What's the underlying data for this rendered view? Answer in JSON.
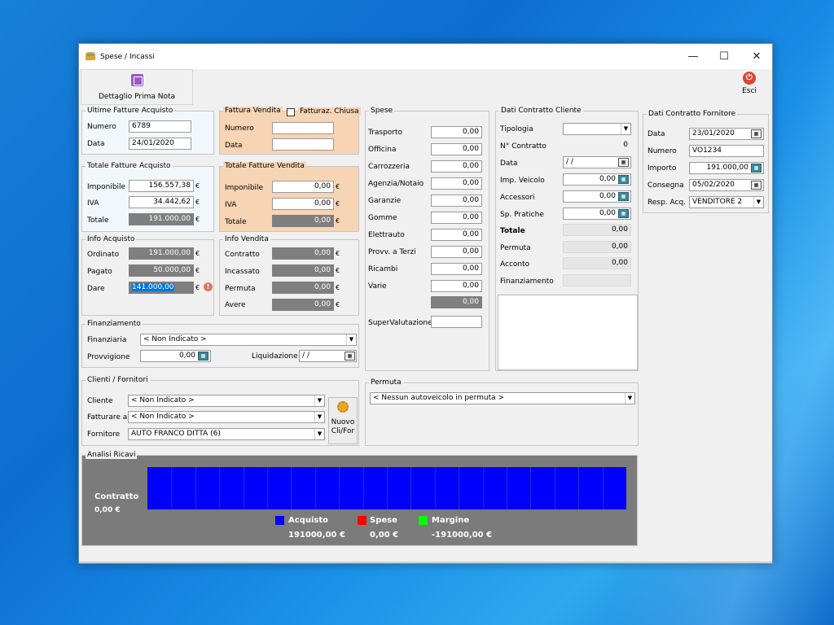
{
  "window": {
    "title": "Spese / Incassi",
    "minimize": "—",
    "maximize": "☐",
    "close": "✕"
  },
  "toolbar": {
    "dettaglio": "Dettaglio Prima Nota",
    "esci": "Esci"
  },
  "ultime_fatture": {
    "title": "Ultime Fatture Acquisto",
    "numero_label": "Numero",
    "numero": "6789",
    "data_label": "Data",
    "data": "24/01/2020"
  },
  "fattura_vendita": {
    "title": "Fattura Vendita",
    "chiusa_label": "Fatturaz. Chiusa",
    "numero_label": "Numero",
    "numero": "",
    "data_label": "Data",
    "data": ""
  },
  "totale_acquisto": {
    "title": "Totale Fatture Acquisto",
    "imponibile_label": "Imponibile",
    "imponibile": "156.557,38",
    "iva_label": "IVA",
    "iva": "34.442,62",
    "totale_label": "Totale",
    "totale": "191.000,00"
  },
  "totale_vendita": {
    "title": "Totale Fatture Vendita",
    "imponibile_label": "Imponibile",
    "imponibile": "0,00",
    "iva_label": "IVA",
    "iva": "0,00",
    "totale_label": "Totale",
    "totale": "0,00"
  },
  "info_acquisto": {
    "title": "Info Acquisto",
    "ordinato_label": "Ordinato",
    "ordinato": "191.000,00",
    "pagato_label": "Pagato",
    "pagato": "50.000,00",
    "dare_label": "Dare",
    "dare": "141.000,00"
  },
  "info_vendita": {
    "title": "Info Vendita",
    "contratto_label": "Contratto",
    "contratto": "0,00",
    "incassato_label": "Incassato",
    "incassato": "0,00",
    "permuta_label": "Permuta",
    "permuta": "0,00",
    "avere_label": "Avere",
    "avere": "0,00"
  },
  "currency": "€",
  "spese": {
    "title": "Spese",
    "items": [
      {
        "label": "Trasporto",
        "value": "0,00"
      },
      {
        "label": "Officina",
        "value": "0,00"
      },
      {
        "label": "Carrozzeria",
        "value": "0,00"
      },
      {
        "label": "Agenzia/Notaio",
        "value": "0,00"
      },
      {
        "label": "Garanzie",
        "value": "0,00"
      },
      {
        "label": "Gomme",
        "value": "0,00"
      },
      {
        "label": "Elettrauto",
        "value": "0,00"
      },
      {
        "label": "Provv. a Terzi",
        "value": "0,00"
      },
      {
        "label": "Ricambi",
        "value": "0,00"
      },
      {
        "label": "Varie",
        "value": "0,00"
      }
    ],
    "totale": "0,00",
    "supervalutazione_label": "SuperValutazione",
    "supervalutazione": ""
  },
  "contratto_cliente": {
    "title": "Dati Contratto Cliente",
    "tipologia_label": "Tipologia",
    "tipologia": "",
    "n_contratto_label": "N° Contratto",
    "n_contratto": "0",
    "data_label": "Data",
    "data": "/ /",
    "imp_veicolo_label": "Imp. Veicolo",
    "imp_veicolo": "0,00",
    "accessori_label": "Accessori",
    "accessori": "0,00",
    "sp_pratiche_label": "Sp. Pratiche",
    "sp_pratiche": "0,00",
    "totale_label": "Totale",
    "totale": "0,00",
    "permuta_label": "Permuta",
    "permuta": "0,00",
    "acconto_label": "Acconto",
    "acconto": "0,00",
    "finanziamento_label": "Finanziamento",
    "finanziamento": ""
  },
  "contratto_fornitore": {
    "title": "Dati Contratto Fornitore",
    "data_label": "Data",
    "data": "23/01/2020",
    "numero_label": "Numero",
    "numero": "VO1234",
    "importo_label": "Importo",
    "importo": "191.000,00",
    "consegna_label": "Consegna",
    "consegna": "05/02/2020",
    "resp_label": "Resp. Acq.",
    "resp": "VENDITORE 2"
  },
  "finanziamento": {
    "title": "Finanziamento",
    "finanziaria_label": "Finanziaria",
    "finanziaria": "< Non Indicato >",
    "provvigione_label": "Provvigione",
    "provvigione": "0,00",
    "liquidazione_label": "Liquidazione",
    "liquidazione": "/ /"
  },
  "clienti": {
    "title": "Clienti / Fornitori",
    "cliente_label": "Cliente",
    "cliente": "< Non Indicato >",
    "fatturare_label": "Fatturare a",
    "fatturare": "< Non Indicato >",
    "fornitore_label": "Fornitore",
    "fornitore": "AUTO FRANCO DITTA (6)",
    "nuovo_label": "Nuovo Cli/For"
  },
  "permuta": {
    "title": "Permuta",
    "value": "< Nessun autoveicolo in permuta >"
  },
  "analisi": {
    "title": "Analisi Ricavi",
    "contratto_label": "Contratto",
    "contratto_value": "0,00 €",
    "legend": [
      {
        "label": "Acquisto",
        "value": "191000,00 €",
        "color": "#0000ff"
      },
      {
        "label": "Spese",
        "value": "0,00 €",
        "color": "#ff0000"
      },
      {
        "label": "Margine",
        "value": "-191000,00 €",
        "color": "#00ff00"
      }
    ]
  }
}
